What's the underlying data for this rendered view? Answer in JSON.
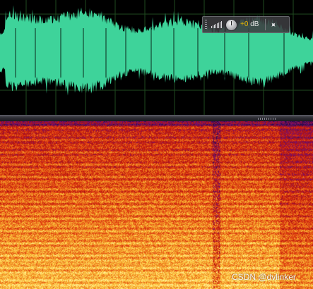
{
  "hud": {
    "gain_value": "+0",
    "gain_unit": "dB",
    "level_icon": "signal-bars-icon",
    "knob_icon": "volume-knob-icon",
    "pin_icon": "pin-icon"
  },
  "waveform": {
    "color": "#3ed39a",
    "background": "#000000",
    "grid_color": "#1f4a1f"
  },
  "spectral": {
    "palette": [
      "#2a0a4a",
      "#7a1070",
      "#b01010",
      "#e03a10",
      "#f08a20",
      "#ffd24a",
      "#fff3a0"
    ]
  },
  "watermark": "CSDN @dvlinker"
}
